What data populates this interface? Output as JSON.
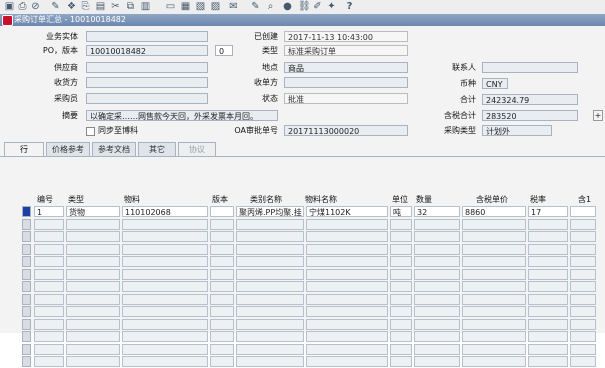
{
  "title_bar": "采购订单汇总 - 10010018482",
  "header": {
    "business_entity": {
      "label": "业务实体",
      "value": ""
    },
    "po_number": {
      "label": "PO，版本",
      "value": "10010018482",
      "revision": "0"
    },
    "supplier": {
      "label": "供应商",
      "value": ""
    },
    "ship_to": {
      "label": "收货方",
      "value": ""
    },
    "buyer": {
      "label": "采购员",
      "value": ""
    },
    "description": {
      "label": "摘要",
      "value": "以确定采……网售款今天回，外采发票本月回。"
    },
    "sync_checkbox": {
      "label": "同步至博科",
      "checked": false
    },
    "created": {
      "label": "已创建",
      "value": "2017-11-13 10:43:00"
    },
    "type": {
      "label": "类型",
      "value": "标准采购订单"
    },
    "site": {
      "label": "地点",
      "value": "商品"
    },
    "bill_to": {
      "label": "收单方",
      "value": ""
    },
    "status": {
      "label": "状态",
      "value": "批准"
    },
    "oa_number": {
      "label": "OA审批单号",
      "value": "20171113000020"
    },
    "contact": {
      "label": "联系人",
      "value": ""
    },
    "currency": {
      "label": "币种",
      "value": "CNY"
    },
    "total": {
      "label": "合计",
      "value": "242324.79"
    },
    "total_tax": {
      "label": "含税合计",
      "value": "283520"
    },
    "purchase_category": {
      "label": "采购类型",
      "value": "计划外"
    },
    "plus_button": "+"
  },
  "tabs": [
    {
      "label": "行",
      "active": true,
      "disabled": false
    },
    {
      "label": "价格参考",
      "active": false,
      "disabled": false
    },
    {
      "label": "参考文档",
      "active": false,
      "disabled": false
    },
    {
      "label": "其它",
      "active": false,
      "disabled": false
    },
    {
      "label": "协议",
      "active": false,
      "disabled": true
    }
  ],
  "grid": {
    "columns": [
      "编号",
      "类型",
      "物料",
      "版本",
      "类别名称",
      "物料名称",
      "单位",
      "数量",
      "含税单价",
      "税率",
      "含1"
    ],
    "rows": [
      [
        "1",
        "货物",
        "110102068",
        "",
        "聚丙烯.PP均聚.挂",
        "宁煤1102K",
        "吨",
        "32",
        "8860",
        "17",
        ""
      ]
    ],
    "empty_rows": 12
  },
  "toolbar_icons": [
    "save-icon",
    "print-icon",
    "navigator-icon",
    "zoom-icon",
    "translations-icon",
    "attachments-icon",
    "folder-icon",
    "cut-icon",
    "copy-icon",
    "paste-icon",
    "clear-icon",
    "delete-icon",
    "edit-icon",
    "help-icon"
  ],
  "toolbar_help": "?"
}
